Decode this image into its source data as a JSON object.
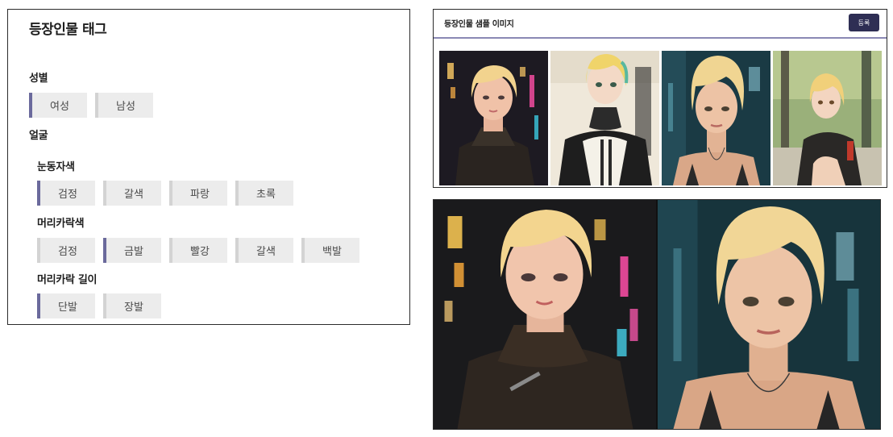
{
  "tags": {
    "title": "등장인물 태그",
    "gender": {
      "heading": "성별",
      "options": [
        "여성",
        "남성"
      ],
      "selected": "여성"
    },
    "face": {
      "heading": "얼굴",
      "eye_color": {
        "heading": "눈동자색",
        "options": [
          "검정",
          "갈색",
          "파랑",
          "초록"
        ],
        "selected": "검정"
      },
      "hair_color": {
        "heading": "머리카락색",
        "options": [
          "검정",
          "금발",
          "빨강",
          "갈색",
          "백발"
        ],
        "selected": "금발"
      },
      "hair_length": {
        "heading": "머리카락 길이",
        "options": [
          "단발",
          "장발"
        ],
        "selected": "단발"
      }
    }
  },
  "samples": {
    "title": "등장인물 샘플 이미지",
    "register_label": "등록",
    "thumbnails": [
      "anime-girl-neon-city",
      "anime-girl-jacket",
      "realistic-woman-city",
      "anime-girl-forest"
    ]
  },
  "preview": {
    "images": [
      "anime-girl-neon-city-large",
      "realistic-woman-city-large"
    ]
  },
  "colors": {
    "accent": "#6b6a9c",
    "button": "#2e2e54",
    "chip_bg": "#ececec",
    "divider": "#8a88b4"
  }
}
